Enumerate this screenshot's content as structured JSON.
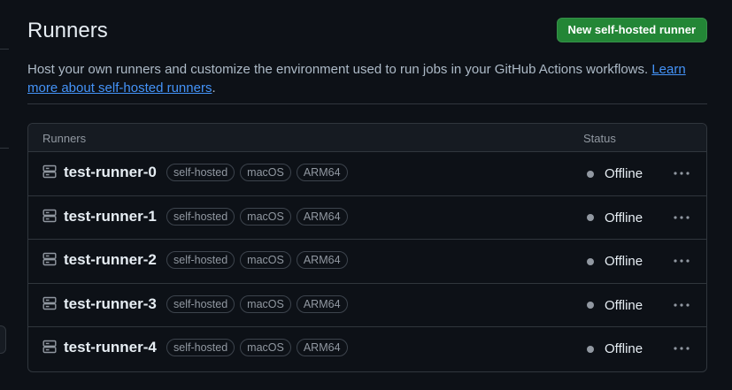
{
  "header": {
    "title": "Runners",
    "new_runner_label": "New self-hosted runner"
  },
  "description": {
    "text": "Host your own runners and customize the environment used to run jobs in your GitHub Actions workflows. ",
    "link_text": "Learn more about self-hosted runners",
    "suffix": "."
  },
  "table": {
    "col_runners": "Runners",
    "col_status": "Status",
    "rows": [
      {
        "name": "test-runner-0",
        "labels": [
          "self-hosted",
          "macOS",
          "ARM64"
        ],
        "status": "Offline"
      },
      {
        "name": "test-runner-1",
        "labels": [
          "self-hosted",
          "macOS",
          "ARM64"
        ],
        "status": "Offline"
      },
      {
        "name": "test-runner-2",
        "labels": [
          "self-hosted",
          "macOS",
          "ARM64"
        ],
        "status": "Offline"
      },
      {
        "name": "test-runner-3",
        "labels": [
          "self-hosted",
          "macOS",
          "ARM64"
        ],
        "status": "Offline"
      },
      {
        "name": "test-runner-4",
        "labels": [
          "self-hosted",
          "macOS",
          "ARM64"
        ],
        "status": "Offline"
      }
    ]
  },
  "colors": {
    "background": "#0d1117",
    "primary_button": "#238636",
    "link": "#4493f8",
    "offline_dot": "#9198a1"
  },
  "icons": {
    "runner": "server-icon",
    "row_menu": "kebab-horizontal-icon"
  }
}
